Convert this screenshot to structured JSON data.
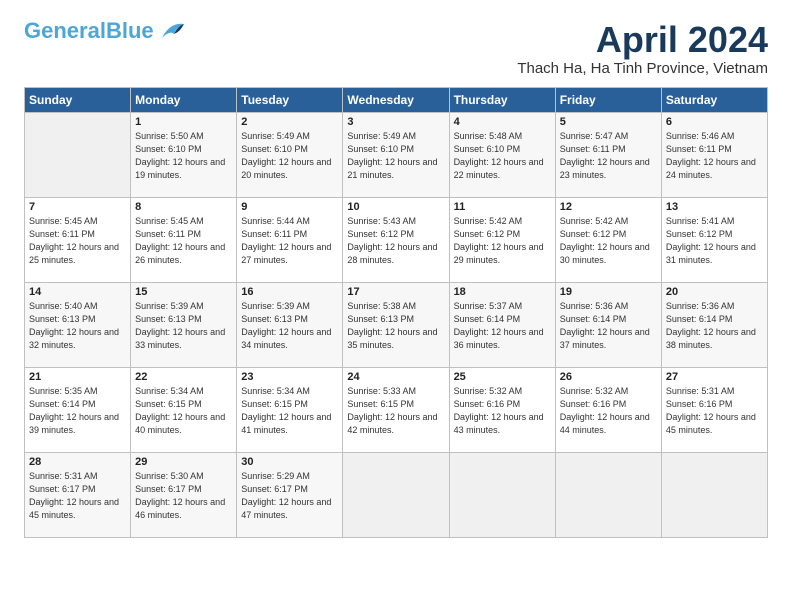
{
  "logo": {
    "text_general": "General",
    "text_blue": "Blue"
  },
  "title": "April 2024",
  "subtitle": "Thach Ha, Ha Tinh Province, Vietnam",
  "days_header": [
    "Sunday",
    "Monday",
    "Tuesday",
    "Wednesday",
    "Thursday",
    "Friday",
    "Saturday"
  ],
  "weeks": [
    [
      {
        "day": "",
        "sunrise": "",
        "sunset": "",
        "daylight": "",
        "empty": true
      },
      {
        "day": "1",
        "sunrise": "5:50 AM",
        "sunset": "6:10 PM",
        "daylight": "12 hours and 19 minutes."
      },
      {
        "day": "2",
        "sunrise": "5:49 AM",
        "sunset": "6:10 PM",
        "daylight": "12 hours and 20 minutes."
      },
      {
        "day": "3",
        "sunrise": "5:49 AM",
        "sunset": "6:10 PM",
        "daylight": "12 hours and 21 minutes."
      },
      {
        "day": "4",
        "sunrise": "5:48 AM",
        "sunset": "6:10 PM",
        "daylight": "12 hours and 22 minutes."
      },
      {
        "day": "5",
        "sunrise": "5:47 AM",
        "sunset": "6:11 PM",
        "daylight": "12 hours and 23 minutes."
      },
      {
        "day": "6",
        "sunrise": "5:46 AM",
        "sunset": "6:11 PM",
        "daylight": "12 hours and 24 minutes."
      }
    ],
    [
      {
        "day": "7",
        "sunrise": "5:45 AM",
        "sunset": "6:11 PM",
        "daylight": "12 hours and 25 minutes."
      },
      {
        "day": "8",
        "sunrise": "5:45 AM",
        "sunset": "6:11 PM",
        "daylight": "12 hours and 26 minutes."
      },
      {
        "day": "9",
        "sunrise": "5:44 AM",
        "sunset": "6:11 PM",
        "daylight": "12 hours and 27 minutes."
      },
      {
        "day": "10",
        "sunrise": "5:43 AM",
        "sunset": "6:12 PM",
        "daylight": "12 hours and 28 minutes."
      },
      {
        "day": "11",
        "sunrise": "5:42 AM",
        "sunset": "6:12 PM",
        "daylight": "12 hours and 29 minutes."
      },
      {
        "day": "12",
        "sunrise": "5:42 AM",
        "sunset": "6:12 PM",
        "daylight": "12 hours and 30 minutes."
      },
      {
        "day": "13",
        "sunrise": "5:41 AM",
        "sunset": "6:12 PM",
        "daylight": "12 hours and 31 minutes."
      }
    ],
    [
      {
        "day": "14",
        "sunrise": "5:40 AM",
        "sunset": "6:13 PM",
        "daylight": "12 hours and 32 minutes."
      },
      {
        "day": "15",
        "sunrise": "5:39 AM",
        "sunset": "6:13 PM",
        "daylight": "12 hours and 33 minutes."
      },
      {
        "day": "16",
        "sunrise": "5:39 AM",
        "sunset": "6:13 PM",
        "daylight": "12 hours and 34 minutes."
      },
      {
        "day": "17",
        "sunrise": "5:38 AM",
        "sunset": "6:13 PM",
        "daylight": "12 hours and 35 minutes."
      },
      {
        "day": "18",
        "sunrise": "5:37 AM",
        "sunset": "6:14 PM",
        "daylight": "12 hours and 36 minutes."
      },
      {
        "day": "19",
        "sunrise": "5:36 AM",
        "sunset": "6:14 PM",
        "daylight": "12 hours and 37 minutes."
      },
      {
        "day": "20",
        "sunrise": "5:36 AM",
        "sunset": "6:14 PM",
        "daylight": "12 hours and 38 minutes."
      }
    ],
    [
      {
        "day": "21",
        "sunrise": "5:35 AM",
        "sunset": "6:14 PM",
        "daylight": "12 hours and 39 minutes."
      },
      {
        "day": "22",
        "sunrise": "5:34 AM",
        "sunset": "6:15 PM",
        "daylight": "12 hours and 40 minutes."
      },
      {
        "day": "23",
        "sunrise": "5:34 AM",
        "sunset": "6:15 PM",
        "daylight": "12 hours and 41 minutes."
      },
      {
        "day": "24",
        "sunrise": "5:33 AM",
        "sunset": "6:15 PM",
        "daylight": "12 hours and 42 minutes."
      },
      {
        "day": "25",
        "sunrise": "5:32 AM",
        "sunset": "6:16 PM",
        "daylight": "12 hours and 43 minutes."
      },
      {
        "day": "26",
        "sunrise": "5:32 AM",
        "sunset": "6:16 PM",
        "daylight": "12 hours and 44 minutes."
      },
      {
        "day": "27",
        "sunrise": "5:31 AM",
        "sunset": "6:16 PM",
        "daylight": "12 hours and 45 minutes."
      }
    ],
    [
      {
        "day": "28",
        "sunrise": "5:31 AM",
        "sunset": "6:17 PM",
        "daylight": "12 hours and 45 minutes."
      },
      {
        "day": "29",
        "sunrise": "5:30 AM",
        "sunset": "6:17 PM",
        "daylight": "12 hours and 46 minutes."
      },
      {
        "day": "30",
        "sunrise": "5:29 AM",
        "sunset": "6:17 PM",
        "daylight": "12 hours and 47 minutes."
      },
      {
        "day": "",
        "sunrise": "",
        "sunset": "",
        "daylight": "",
        "empty": true
      },
      {
        "day": "",
        "sunrise": "",
        "sunset": "",
        "daylight": "",
        "empty": true
      },
      {
        "day": "",
        "sunrise": "",
        "sunset": "",
        "daylight": "",
        "empty": true
      },
      {
        "day": "",
        "sunrise": "",
        "sunset": "",
        "daylight": "",
        "empty": true
      }
    ]
  ],
  "labels": {
    "sunrise": "Sunrise:",
    "sunset": "Sunset:",
    "daylight": "Daylight:"
  }
}
